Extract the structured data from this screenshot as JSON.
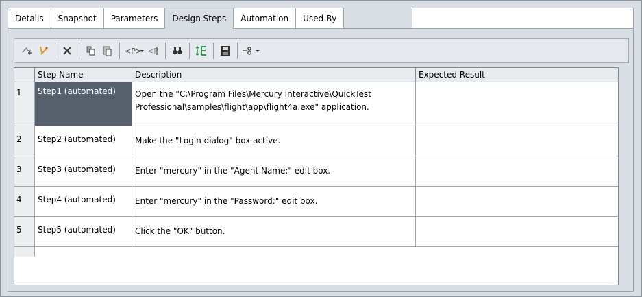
{
  "tabs": [
    "Details",
    "Snapshot",
    "Parameters",
    "Design Steps",
    "Automation",
    "Used By"
  ],
  "active_tab": "Design Steps",
  "toolbar": {
    "icons": [
      "new-step-icon",
      "call-to-test-icon",
      "delete-icon",
      "copy-icon",
      "paste-icon",
      "insert-parameter-icon",
      "rename-icon",
      "find-icon",
      "renumber-steps-icon",
      "save-icon",
      "link-icon"
    ]
  },
  "grid": {
    "columns": [
      "Step Name",
      "Description",
      "Expected Result"
    ],
    "rows": [
      {
        "num": "1",
        "name": "Step1 (automated)",
        "desc_line1": "Open the  \"C:\\Program Files\\Mercury Interactive\\QuickTest",
        "desc_line2": "Professional\\samples\\flight\\app\\flight4a.exe\" application.",
        "expected": ""
      },
      {
        "num": "2",
        "name": "Step2 (automated)",
        "desc_line1": "Make the \"Login dialog\" box active.",
        "desc_line2": "",
        "expected": ""
      },
      {
        "num": "3",
        "name": "Step3 (automated)",
        "desc_line1": "Enter \"mercury\" in the \"Agent Name:\" edit box.",
        "desc_line2": "",
        "expected": ""
      },
      {
        "num": "4",
        "name": "Step4 (automated)",
        "desc_line1": "Enter \"mercury\" in the \"Password:\" edit box.",
        "desc_line2": "",
        "expected": ""
      },
      {
        "num": "5",
        "name": "Step5 (automated)",
        "desc_line1": "Click the \"OK\" button.",
        "desc_line2": "",
        "expected": ""
      }
    ]
  }
}
